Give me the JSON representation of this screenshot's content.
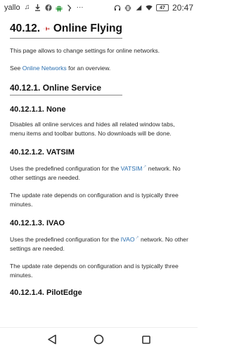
{
  "status_bar": {
    "carrier": "yallo",
    "clock": "20:47",
    "battery": "47"
  },
  "page": {
    "title": "40.12. ✈ Online Flying",
    "title_prefix": "40.12.",
    "title_text": "Online Flying",
    "intro": "This page allows to change settings for online networks.",
    "see_prefix": "See ",
    "see_link": "Online Networks",
    "see_suffix": " for an overview.",
    "section": "40.12.1. Online Service",
    "none_heading": "40.12.1.1. None",
    "none_text": "Disables all online services and hides all related window tabs, menu items and toolbar buttons. No downloads will be done.",
    "vatsim_heading": "40.12.1.2. VATSIM",
    "vatsim_text1_prefix": "Uses the predefined configuration for the ",
    "vatsim_link": "VATSIM",
    "vatsim_text1_suffix": " network. No other settings are needed.",
    "vatsim_text2": "The update rate depends on configuration and is typically three minutes.",
    "ivao_heading": "40.12.1.3. IVAO",
    "ivao_text1_prefix": "Uses the predefined configuration for the ",
    "ivao_link": "IVAO",
    "ivao_text1_suffix": " network. No other settings are needed.",
    "ivao_text2": "The update rate depends on configuration and is typically three minutes.",
    "pilotedge_heading": "40.12.1.4. PilotEdge"
  },
  "colors": {
    "link": "#2a6fb0",
    "plane": "#c0221c"
  }
}
